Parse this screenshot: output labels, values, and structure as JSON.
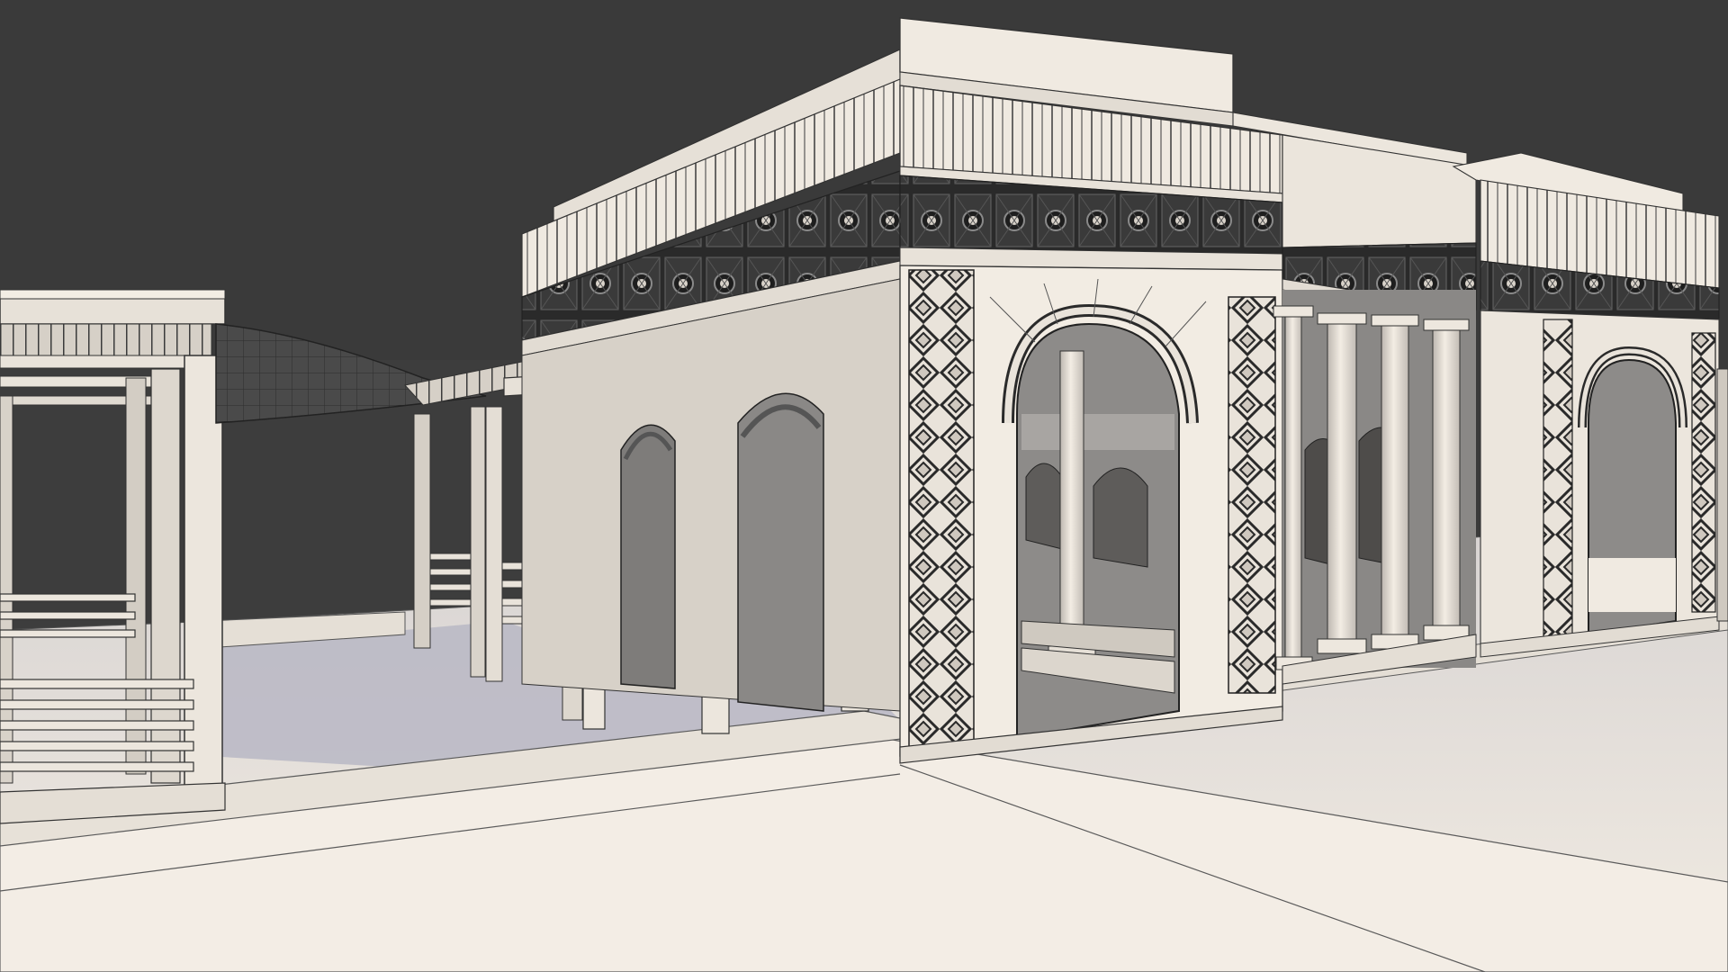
{
  "viewport": {
    "background_color": "#3a3a3a",
    "render_style": "clay-render-with-wireframe",
    "subject": "classical-arched-pavilion-with-pergolas"
  },
  "colors": {
    "surface_light": "#f4eee6",
    "surface_mid": "#e2dbd2",
    "surface_shade": "#cbc5be",
    "ground": "#f1ebe2",
    "ground_shadow": "#b9b8c4",
    "wire": "#3b3b3b",
    "ornament_dark": "#262626",
    "interior_dark": "#8c8a88"
  },
  "scene_elements": {
    "building": "main-pavilion",
    "arches_front": 1,
    "arches_side": 2,
    "columns_colonnade": 4,
    "pergolas": 2,
    "shade_canopy": "curved-sail"
  }
}
